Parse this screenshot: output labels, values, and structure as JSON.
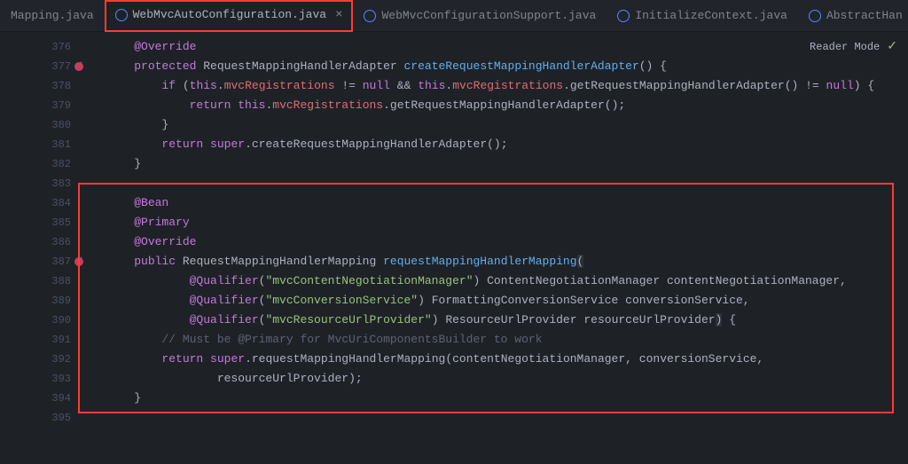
{
  "tabs": [
    {
      "label": "Mapping.java"
    },
    {
      "label": "WebMvcAutoConfiguration.java",
      "active": true
    },
    {
      "label": "WebMvcConfigurationSupport.java"
    },
    {
      "label": "InitializeContext.java"
    },
    {
      "label": "AbstractHan"
    }
  ],
  "readerMode": "Reader Mode",
  "lines": {
    "376": "376",
    "377": "377",
    "378": "378",
    "379": "379",
    "380": "380",
    "381": "381",
    "382": "382",
    "383": "383",
    "384": "384",
    "385": "385",
    "386": "386",
    "387": "387",
    "388": "388",
    "389": "389",
    "390": "390",
    "391": "391",
    "392": "392",
    "393": "393",
    "394": "394",
    "395": "395"
  },
  "code": {
    "override1": "@Override",
    "protected": "protected",
    "type_adapter": "RequestMappingHandlerAdapter",
    "m_create": "createRequestMappingHandlerAdapter",
    "if": "if",
    "this": "this",
    "f_mvcReg": "mvcRegistrations",
    "null": "null",
    "and": "&&",
    "m_getAdapter": "getRequestMappingHandlerAdapter",
    "return": "return",
    "super": "super",
    "bean": "@Bean",
    "primary": "@Primary",
    "override2": "@Override",
    "public": "public",
    "type_mapping": "RequestMappingHandlerMapping",
    "m_req": "requestMappingHandlerMapping",
    "qualifier": "@Qualifier",
    "s_neg": "\"mvcContentNegotiationManager\"",
    "t_neg": "ContentNegotiationManager",
    "p_neg": "contentNegotiationManager",
    "s_conv": "\"mvcConversionService\"",
    "t_conv": "FormattingConversionService",
    "p_conv": "conversionService",
    "s_url": "\"mvcResourceUrlProvider\"",
    "t_url": "ResourceUrlProvider",
    "p_url": "resourceUrlProvider",
    "comment": "// Must be @Primary for MvcUriComponentsBuilder to work",
    "m_reqCall": "requestMappingHandlerMapping"
  }
}
